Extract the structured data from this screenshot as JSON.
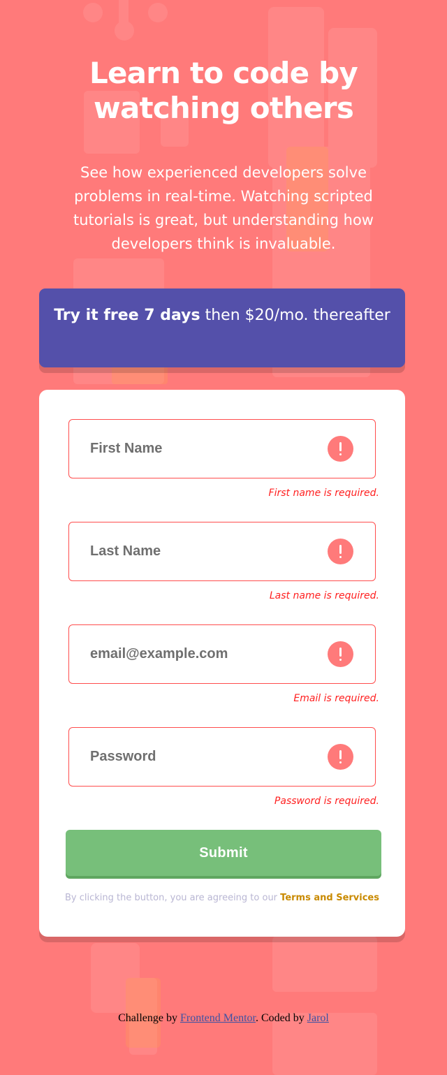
{
  "hero": {
    "title": "Learn to code by watching others",
    "intro": "See how experienced developers solve problems in real-time. Watching scripted tutorials is great, but understanding how developers think is invaluable."
  },
  "promo": {
    "strong": "Try it free 7 days",
    "rest": " then $20/mo. thereafter"
  },
  "form": {
    "fields": [
      {
        "placeholder": "First Name",
        "value": "",
        "error": "First name is required."
      },
      {
        "placeholder": "Last Name",
        "value": "",
        "error": "Last name is required."
      },
      {
        "placeholder": "email@example.com",
        "value": "",
        "error": "Email is required."
      },
      {
        "placeholder": "Password",
        "value": "",
        "error": "Password is required."
      }
    ],
    "submit_label": "Submit",
    "terms_prefix": "By clicking the button, you are agreeing to our ",
    "terms_link": "Terms and Services"
  },
  "footer": {
    "prefix": "Challenge by ",
    "link1": "Frontend Mentor",
    "middle": ". Coded by ",
    "link2": "Jarol"
  },
  "colors": {
    "background": "#ff7a7a",
    "promo": "#5450aa",
    "submit": "#77bf7a",
    "error": "#ff4d4d",
    "terms_link": "#c98a00"
  },
  "icons": {
    "error": "error-icon"
  }
}
